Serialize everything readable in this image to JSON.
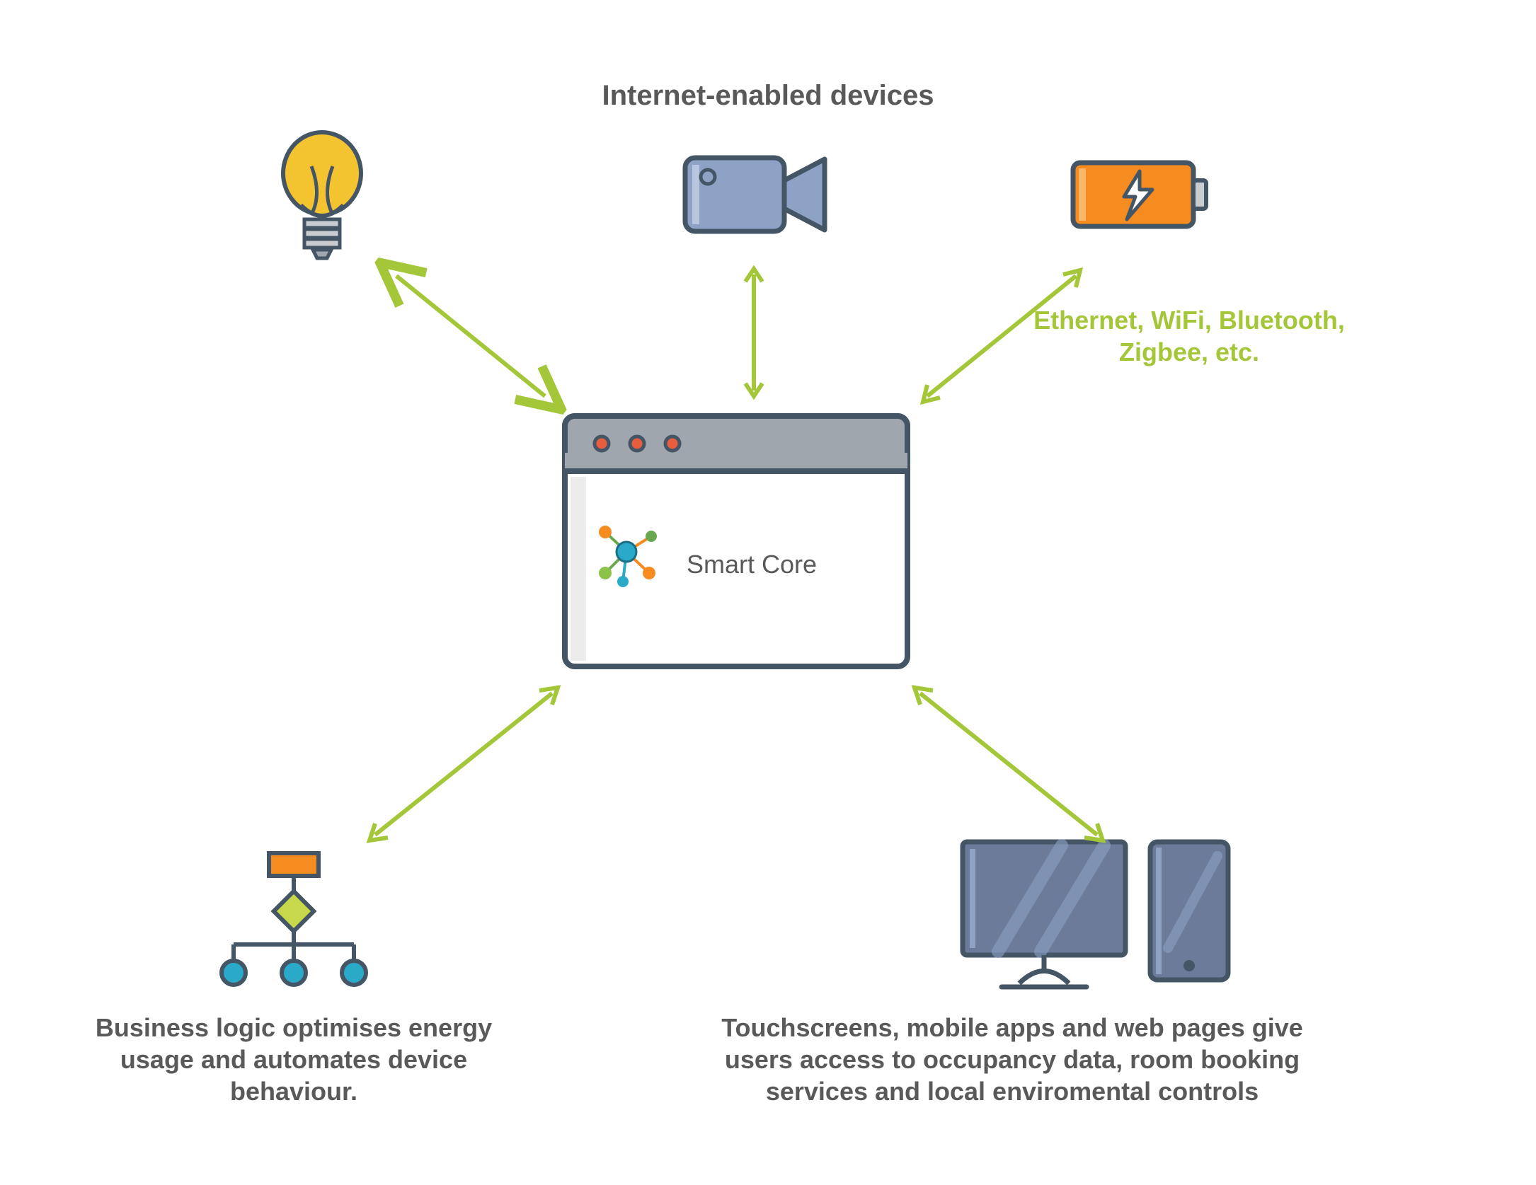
{
  "heading": "Internet-enabled devices",
  "protocols": "Ethernet, WiFi, Bluetooth, Zigbee, etc.",
  "business_logic": "Business logic optimises energy usage and automates device behaviour.",
  "user_interfaces": "Touchscreens, mobile apps and web pages give users access to occupancy data, room booking services and local enviromental controls",
  "core_label": "Smart Core",
  "colors": {
    "arrow": "#a4c639",
    "text": "#595959",
    "protocol_text": "#a4c639",
    "stroke": "#445566",
    "yellow": "#f4c430",
    "orange": "#f68b1f",
    "blue_steel": "#8ea2c6",
    "slate": "#6b7b99",
    "grey": "#9fa6ad",
    "teal": "#2aa9c9"
  }
}
